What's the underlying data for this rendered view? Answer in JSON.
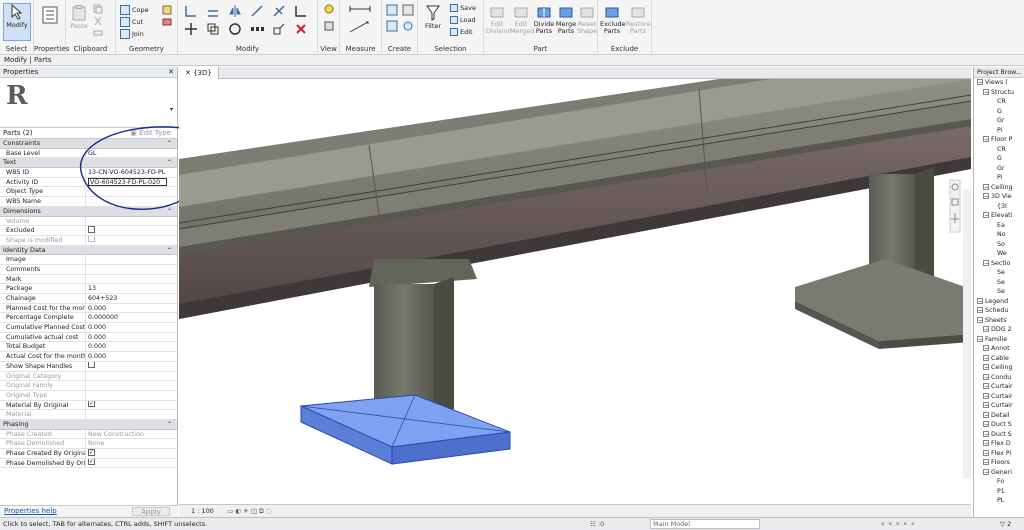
{
  "ribbon": {
    "panels": {
      "select": "Select",
      "properties": "Properties",
      "clipboard": "Clipboard",
      "geometry": "Geometry",
      "modify": "Modify",
      "view": "View",
      "measure": "Measure",
      "create": "Create",
      "selection": "Selection",
      "part": "Part",
      "exclude": "Exclude"
    },
    "buttons": {
      "modify": "Modify",
      "paste": "Paste",
      "cope": "Cope",
      "cut": "Cut",
      "join": "Join",
      "filter": "Filter",
      "save": "Save",
      "load": "Load",
      "edit": "Edit",
      "edit_division": "Edit Division",
      "edit_merged": "Edit Merged",
      "divide_parts": "Divide Parts",
      "merge_parts": "Merge Parts",
      "reset_shape": "Reset Shape",
      "exclude_parts": "Exclude Parts",
      "restore_parts": "Restore Parts"
    }
  },
  "context_bar": "Modify | Parts",
  "properties": {
    "title": "Properties",
    "selection": "Parts (2)",
    "edit_type": "Edit Type",
    "sections": {
      "constraints": "Constraints",
      "text": "Text",
      "dimensions": "Dimensions",
      "identity": "Identity Data",
      "phasing": "Phasing"
    },
    "rows": {
      "base_level": {
        "k": "Base Level",
        "v": "GL"
      },
      "wbs_id": {
        "k": "WBS ID",
        "v": "13-CN-VO-604523-FD-PL"
      },
      "activity_id": {
        "k": "Activity ID",
        "v": "VO-604523-FD-PL-020"
      },
      "object_type": {
        "k": "Object Type",
        "v": ""
      },
      "wbs_name": {
        "k": "WBS Name",
        "v": ""
      },
      "volume": {
        "k": "Volume",
        "v": ""
      },
      "excluded": {
        "k": "Excluded",
        "v": ""
      },
      "shape_modified": {
        "k": "Shape is modified",
        "v": ""
      },
      "image": {
        "k": "Image",
        "v": ""
      },
      "comments": {
        "k": "Comments",
        "v": ""
      },
      "mark": {
        "k": "Mark",
        "v": ""
      },
      "package": {
        "k": "Package",
        "v": "13"
      },
      "chainage": {
        "k": "Chainage",
        "v": "604+523"
      },
      "planned_cost": {
        "k": "Planned Cost for the month",
        "v": "0.000"
      },
      "pct_complete": {
        "k": "Percentage Complete",
        "v": "0.000000"
      },
      "cum_planned": {
        "k": "Cumulative Planned Cost",
        "v": "0.000"
      },
      "cum_actual": {
        "k": "Cumulative actual cost",
        "v": "0.000"
      },
      "total_budget": {
        "k": "Total Budget",
        "v": "0.000"
      },
      "actual_cost": {
        "k": "Actual Cost for the month",
        "v": "0.000"
      },
      "show_handles": {
        "k": "Show Shape Handles",
        "v": ""
      },
      "orig_category": {
        "k": "Original Category",
        "v": ""
      },
      "orig_family": {
        "k": "Original Family",
        "v": ""
      },
      "orig_type": {
        "k": "Original Type",
        "v": ""
      },
      "material_by_orig": {
        "k": "Material By Original",
        "v": ""
      },
      "material": {
        "k": "Material",
        "v": ""
      },
      "phase_created": {
        "k": "Phase Created",
        "v": "New Construction"
      },
      "phase_demolished": {
        "k": "Phase Demolished",
        "v": "None"
      },
      "phase_created_by": {
        "k": "Phase Created By Original",
        "v": ""
      },
      "phase_demolished_by": {
        "k": "Phase Demolished By Ori...",
        "v": ""
      }
    },
    "help": "Properties help",
    "apply": "Apply"
  },
  "view": {
    "tab": "{3D}",
    "scale": "1 : 100"
  },
  "browser": {
    "title": "Project Brow...",
    "items": [
      "Views (",
      "Structu",
      "CR",
      "G",
      "Gr",
      "Pi",
      "Floor P",
      "CR",
      "G",
      "Gr",
      "Pi",
      "Ceiling",
      "3D Vie",
      "{3I",
      "Elevati",
      "Ea",
      "No",
      "So",
      "We",
      "Sectio",
      "Se",
      "Se",
      "Se",
      "Legend",
      "Schedu",
      "Sheets",
      "DDG 2",
      "Familie",
      "Annot",
      "Cable",
      "Ceiling",
      "Condu",
      "Curtair",
      "Curtair",
      "Curtair",
      "Detail",
      "Duct S",
      "Duct S",
      "Flex D",
      "Flex Pi",
      "Floors",
      "Generi",
      "Fo",
      "P1",
      "PL"
    ]
  },
  "status": {
    "message": "Click to select, TAB for alternates, CTRL adds, SHIFT unselects.",
    "model": "Main Model",
    "zero": ":0",
    "filter_count": "2"
  },
  "colors": {
    "selection_blue": "#4d7be0",
    "ribbon_bg": "#f4f4f4",
    "annotation_ink": "#1a2a8c"
  }
}
